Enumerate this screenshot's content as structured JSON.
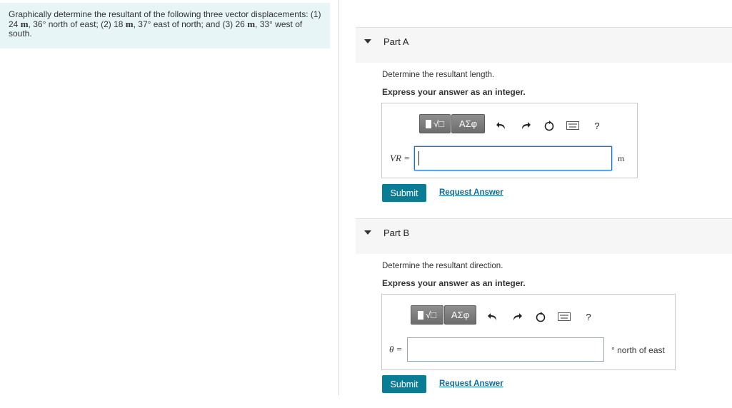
{
  "problem": {
    "line1": "Graphically determine the resultant of the following three vector displacements: (1)",
    "line2_a": "24",
    "line2_m1": "m",
    "line2_b": ", 36° north of east; (2) 18",
    "line2_m2": "m",
    "line2_c": ", 37° east of north; and (3) 26",
    "line2_m3": "m",
    "line2_d": ", 33° west of",
    "line3": "south."
  },
  "partA": {
    "title": "Part A",
    "prompt": "Determine the resultant length.",
    "instruction": "Express your answer as an integer.",
    "variable": "VR =",
    "unit": "m",
    "input_value": "",
    "submit": "Submit",
    "request": "Request Answer"
  },
  "partB": {
    "title": "Part B",
    "prompt": "Determine the resultant direction.",
    "instruction": "Express your answer as an integer.",
    "variable": "θ =",
    "unit": "° north of east",
    "input_value": "",
    "submit": "Submit",
    "request": "Request Answer"
  },
  "toolbar": {
    "templates": "√□",
    "greek": "ΑΣφ",
    "help": "?"
  },
  "colors": {
    "accent": "#0b7c95",
    "link": "#0b6fa4",
    "problem_bg": "#e8f5f7",
    "active_input_border": "#1a73c9"
  },
  "icons": [
    "templates-icon",
    "greek-icon",
    "undo-icon",
    "redo-icon",
    "reset-icon",
    "keyboard-icon",
    "help-icon"
  ]
}
